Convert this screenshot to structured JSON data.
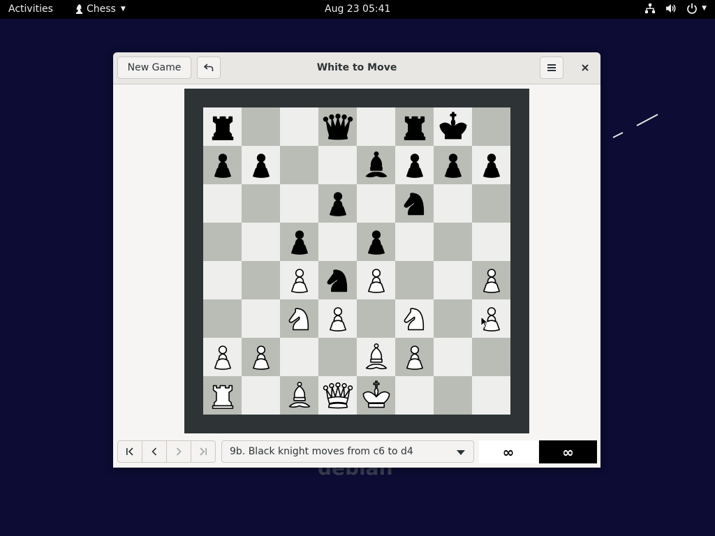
{
  "topbar": {
    "activities": "Activities",
    "app_name": "Chess",
    "clock": "Aug 23  05:41"
  },
  "window": {
    "title": "White to Move",
    "new_game_label": "New Game"
  },
  "board": {
    "ranks": [
      [
        "bR",
        "",
        "",
        "bQ",
        "",
        "bR",
        "bK",
        ""
      ],
      [
        "bP",
        "bP",
        "",
        "",
        "bB",
        "bP",
        "bP",
        "bP"
      ],
      [
        "",
        "",
        "",
        "bP",
        "",
        "bN",
        "",
        ""
      ],
      [
        "",
        "",
        "bP",
        "",
        "bP",
        "",
        "",
        ""
      ],
      [
        "",
        "",
        "wP",
        "bN",
        "wP",
        "",
        "",
        "wP"
      ],
      [
        "",
        "",
        "wN",
        "wP",
        "",
        "wN",
        "",
        "wP"
      ],
      [
        "wP",
        "wP",
        "",
        "",
        "wB",
        "wP",
        "",
        ""
      ],
      [
        "wR",
        "",
        "wB",
        "wQ",
        "wK",
        "",
        "",
        ""
      ]
    ],
    "light_color": "#eeeeec",
    "dark_color": "#babdb6",
    "frame_color": "#2e3436"
  },
  "history": {
    "selected": "9b. Black knight moves from c6 to d4"
  },
  "clocks": {
    "white": "∞",
    "black": "∞"
  }
}
